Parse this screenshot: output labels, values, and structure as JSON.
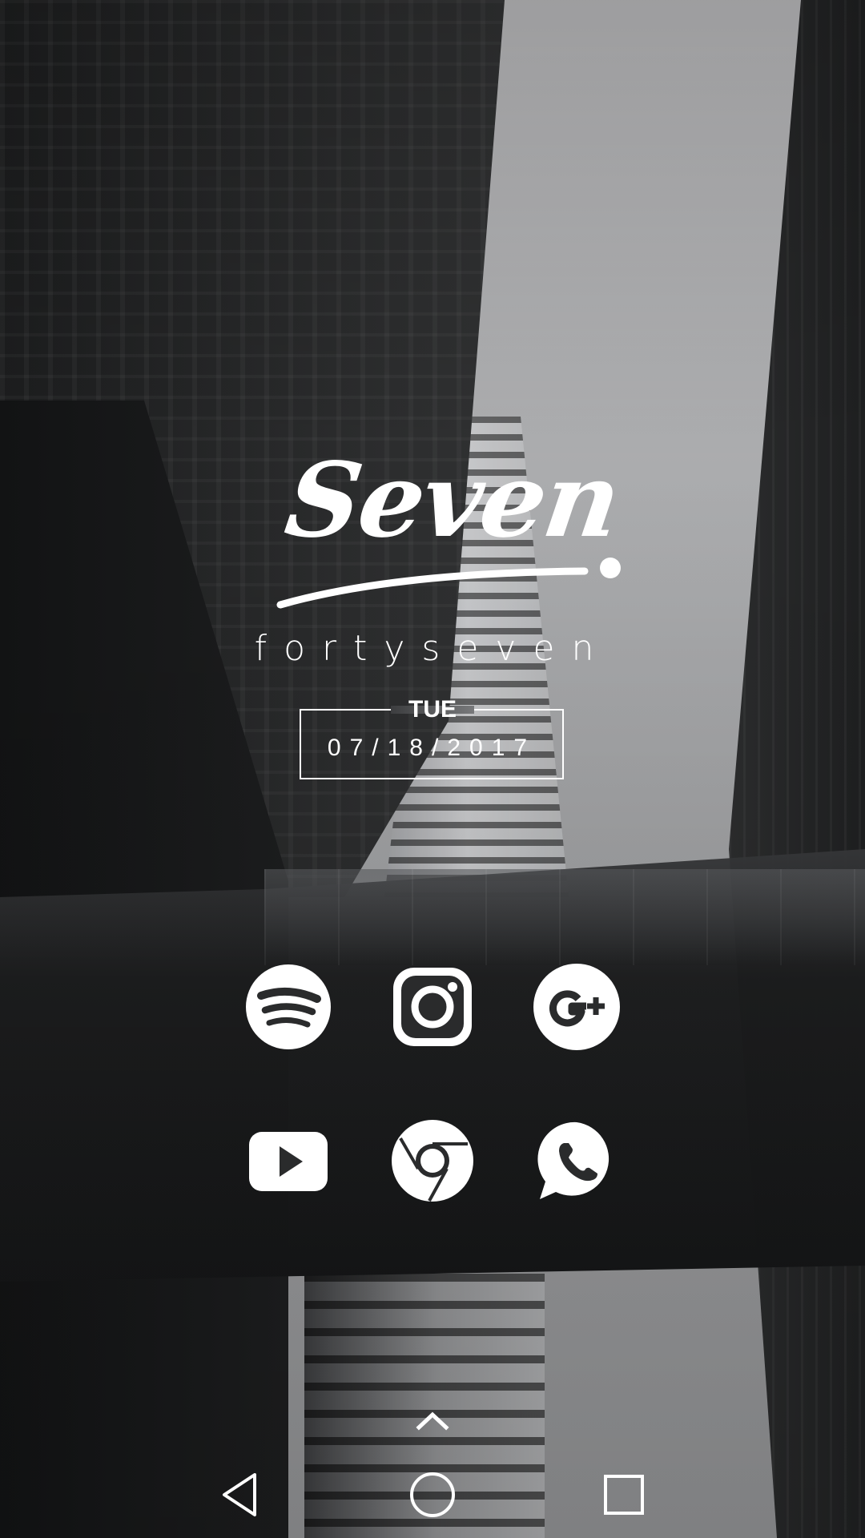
{
  "logo": {
    "title": "Seven",
    "subtitle": "fortyseven"
  },
  "date_widget": {
    "day": "TUE",
    "date": "07/18/2017"
  },
  "apps": [
    {
      "id": "spotify",
      "icon": "spotify-icon"
    },
    {
      "id": "instagram",
      "icon": "instagram-icon"
    },
    {
      "id": "google-plus",
      "icon": "google-plus-icon"
    },
    {
      "id": "youtube",
      "icon": "youtube-icon"
    },
    {
      "id": "chrome",
      "icon": "chrome-icon"
    },
    {
      "id": "whatsapp",
      "icon": "whatsapp-icon"
    }
  ],
  "navigation": {
    "drawer_handle": "chevron-up-icon",
    "back": "back-triangle-icon",
    "home": "home-circle-icon",
    "recents": "recents-square-icon"
  },
  "colors": {
    "foreground": "#ffffff",
    "icon_cutout": "#2a2b2c"
  }
}
